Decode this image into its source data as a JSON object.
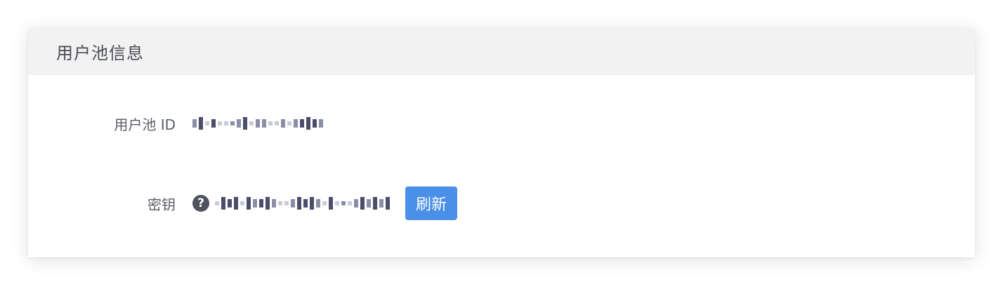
{
  "panel": {
    "title": "用户池信息"
  },
  "fields": {
    "pool_id": {
      "label": "用户池 ID"
    },
    "secret": {
      "label": "密钥",
      "help_icon": "question-circle-icon",
      "refresh_label": "刷新"
    }
  },
  "colors": {
    "header_bg": "#f2f2f2",
    "accent": "#4a8fe8",
    "label_text": "#5a5d66"
  }
}
